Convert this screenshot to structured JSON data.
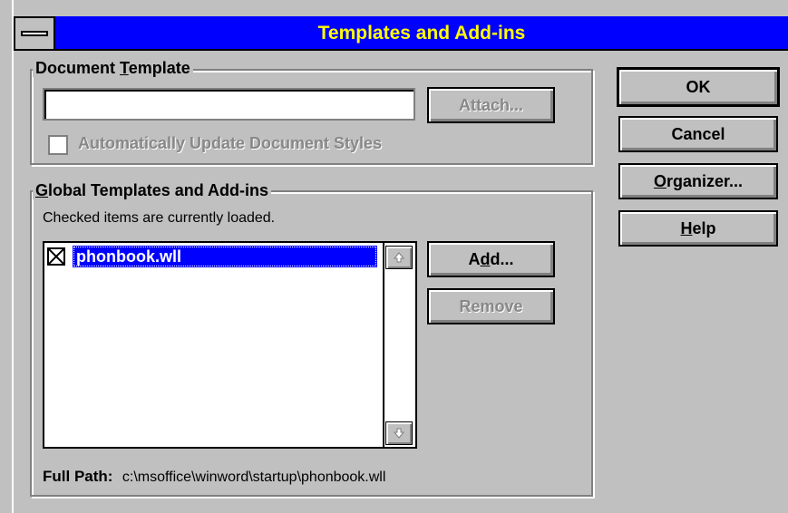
{
  "title": "Templates and Add-ins",
  "document_template": {
    "legend_pre": "Document ",
    "legend_mnemonic": "T",
    "legend_post": "emplate",
    "path_value": "",
    "attach_label": "Attach...",
    "auto_update_label": "Automatically Update Document Styles"
  },
  "global": {
    "legend_mnemonic": "G",
    "legend_post": "lobal Templates and Add-ins",
    "hint": "Checked items are currently loaded.",
    "items": [
      {
        "label": "phonbook.wll",
        "checked": true,
        "selected": true
      }
    ],
    "add_pre": "A",
    "add_mnemonic": "d",
    "add_post": "d...",
    "remove_label": "Remove",
    "full_path_label": "Full Path:",
    "full_path_value": "c:\\msoffice\\winword\\startup\\phonbook.wll"
  },
  "buttons": {
    "ok": "OK",
    "cancel": "Cancel",
    "organizer_mnemonic": "O",
    "organizer_post": "rganizer...",
    "help_mnemonic": "H",
    "help_post": "elp"
  },
  "icons": {
    "system_menu": "system-menu-icon",
    "scroll_up": "scroll-up-arrow-icon",
    "scroll_down": "scroll-down-arrow-icon",
    "checkbox_checked": "x-check-icon"
  },
  "colors": {
    "titlebar": "#0000ff",
    "title_text": "#ffff00",
    "selection": "#0000ff",
    "face": "#c0c0c0",
    "disabled_text": "#888888"
  }
}
